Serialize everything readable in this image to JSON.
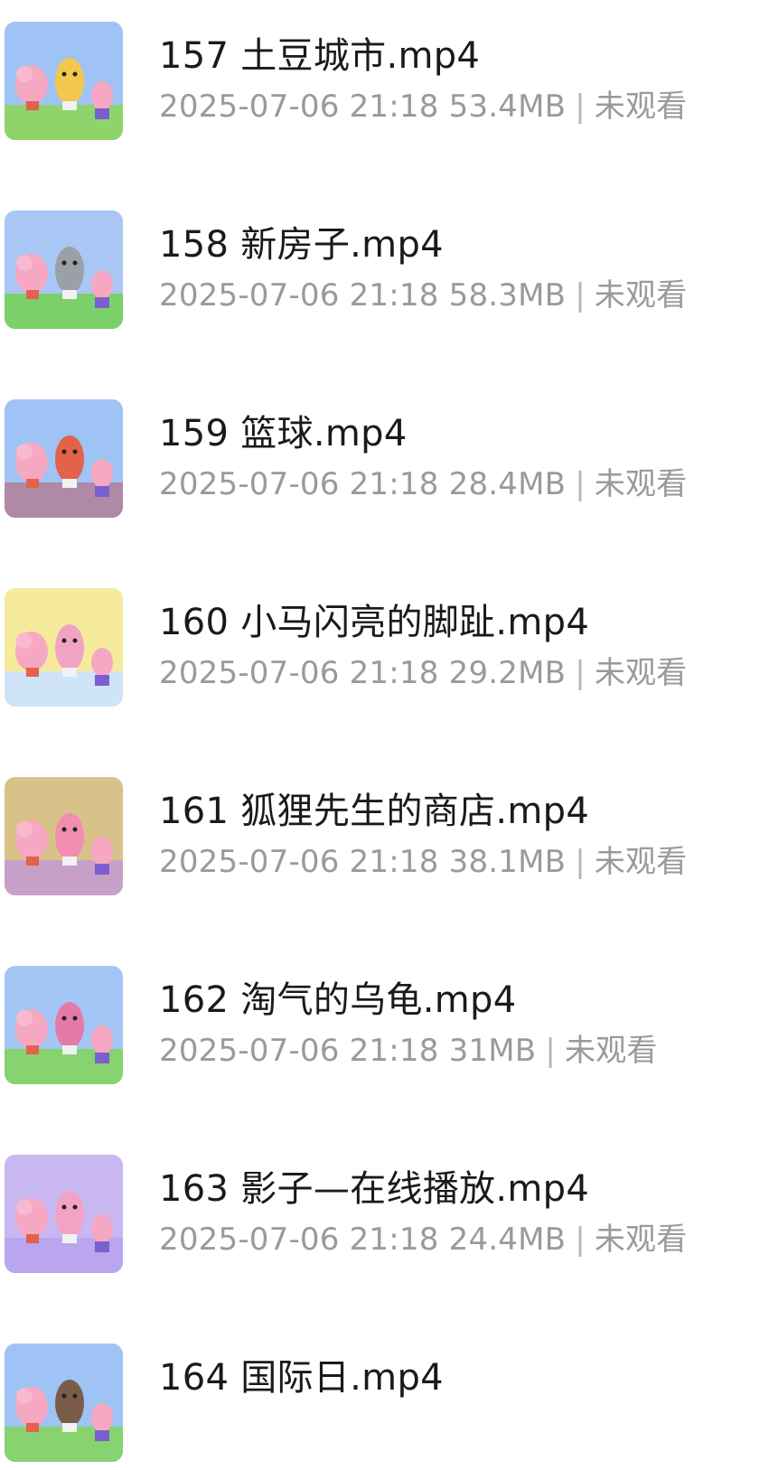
{
  "files": [
    {
      "title": "157 土豆城市.mp4",
      "date": "2025-07-06 21:18",
      "size": "53.4MB",
      "status": "未观看",
      "thumb": {
        "sky": "#9ec3f4",
        "ground": "#8fd46a",
        "accent": "#f2c94c"
      }
    },
    {
      "title": "158 新房子.mp4",
      "date": "2025-07-06 21:18",
      "size": "58.3MB",
      "status": "未观看",
      "thumb": {
        "sky": "#a9c7f5",
        "ground": "#7bd06a",
        "accent": "#9aa0a6"
      }
    },
    {
      "title": "159 篮球.mp4",
      "date": "2025-07-06 21:18",
      "size": "28.4MB",
      "status": "未观看",
      "thumb": {
        "sky": "#9ec3f4",
        "ground": "#b089a6",
        "accent": "#e2624a"
      }
    },
    {
      "title": "160 小马闪亮的脚趾.mp4",
      "date": "2025-07-06 21:18",
      "size": "29.2MB",
      "status": "未观看",
      "thumb": {
        "sky": "#f6ea9c",
        "ground": "#cfe4f7",
        "accent": "#f2a3c4"
      }
    },
    {
      "title": "161 狐狸先生的商店.mp4",
      "date": "2025-07-06 21:18",
      "size": "38.1MB",
      "status": "未观看",
      "thumb": {
        "sky": "#d9c28a",
        "ground": "#c7a0c8",
        "accent": "#f28db0"
      }
    },
    {
      "title": "162 淘气的乌龟.mp4",
      "date": "2025-07-06 21:18",
      "size": "31MB",
      "status": "未观看",
      "thumb": {
        "sky": "#a3c6f5",
        "ground": "#86d36f",
        "accent": "#e47aa8"
      }
    },
    {
      "title": "163 影子—在线播放.mp4",
      "date": "2025-07-06 21:18",
      "size": "24.4MB",
      "status": "未观看",
      "thumb": {
        "sky": "#c9b7f2",
        "ground": "#b9a6ee",
        "accent": "#f2a3c4"
      }
    },
    {
      "title": "164 国际日.mp4",
      "date": "",
      "size": "",
      "status": "",
      "thumb": {
        "sky": "#9ec3f4",
        "ground": "#86d36f",
        "accent": "#7a5c4a"
      }
    }
  ]
}
